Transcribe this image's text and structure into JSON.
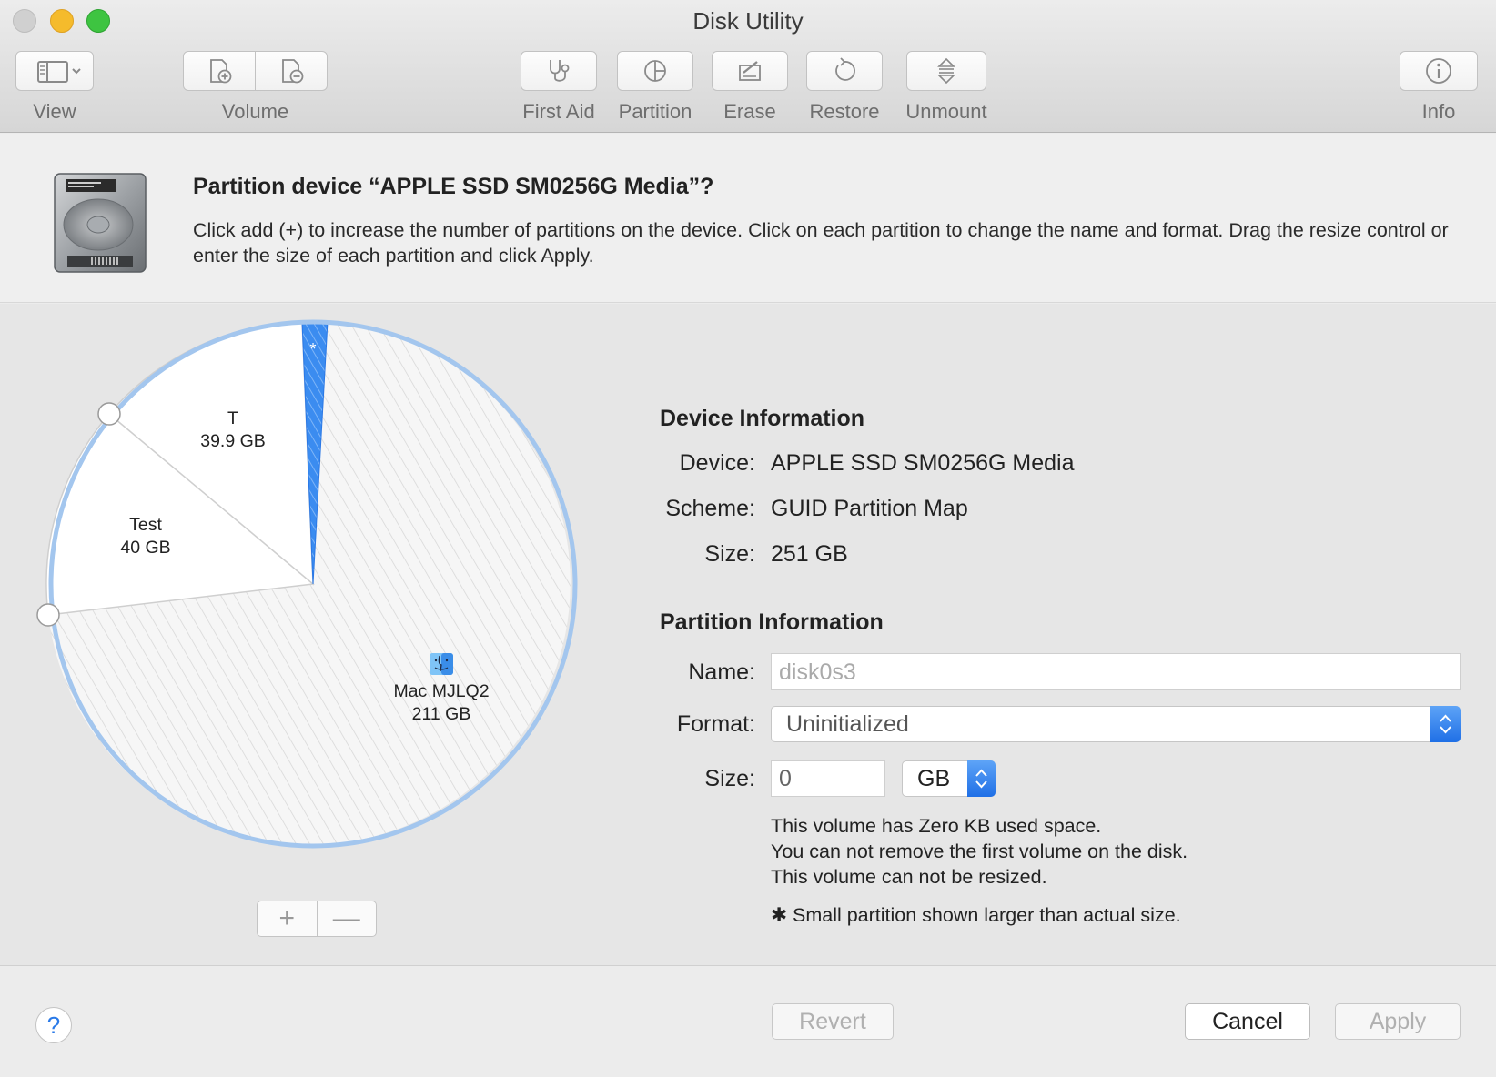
{
  "window": {
    "title": "Disk Utility"
  },
  "toolbar": {
    "view_label": "View",
    "volume_label": "Volume",
    "first_aid_label": "First Aid",
    "partition_label": "Partition",
    "erase_label": "Erase",
    "restore_label": "Restore",
    "unmount_label": "Unmount",
    "info_label": "Info"
  },
  "header": {
    "title": "Partition device “APPLE SSD SM0256G Media”?",
    "description": "Click add (+) to increase the number of partitions on the device. Click on each partition to change the name and format. Drag the resize control or enter the size of each partition and click Apply."
  },
  "pie": {
    "small_marker": "*",
    "partitions": [
      {
        "name": "T",
        "size": "39.9 GB"
      },
      {
        "name": "Test",
        "size": "40 GB"
      },
      {
        "name": "Mac MJLQ2",
        "size": "211 GB"
      }
    ],
    "add_symbol": "+",
    "remove_symbol": "—"
  },
  "device_info": {
    "title": "Device Information",
    "device_label": "Device:",
    "device_value": "APPLE SSD SM0256G Media",
    "scheme_label": "Scheme:",
    "scheme_value": "GUID Partition Map",
    "size_label": "Size:",
    "size_value": "251 GB"
  },
  "partition_info": {
    "title": "Partition Information",
    "name_label": "Name:",
    "name_placeholder": "disk0s3",
    "format_label": "Format:",
    "format_value": "Uninitialized",
    "size_label": "Size:",
    "size_value": "0",
    "unit_value": "GB",
    "note1": "This volume has Zero KB used space.",
    "note2": "You can not remove the first volume on the disk.",
    "note3": "This volume can not be resized.",
    "footnote": "✱ Small partition shown larger than actual size."
  },
  "footer": {
    "help_label": "?",
    "revert_label": "Revert",
    "cancel_label": "Cancel",
    "apply_label": "Apply"
  },
  "colors": {
    "accent": "#3b8cf0",
    "pie_border": "#a3c6ee"
  }
}
